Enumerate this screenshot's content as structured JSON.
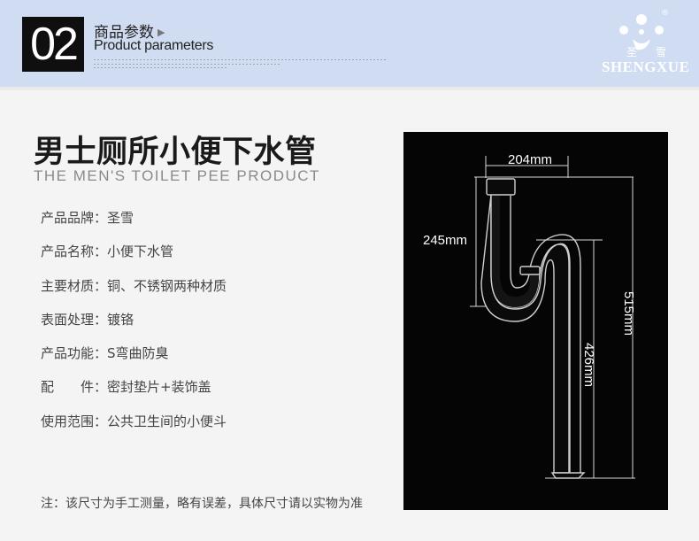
{
  "header": {
    "number": "02",
    "title_cn": "商品参数",
    "title_arrow": "▶",
    "title_en": "Product parameters"
  },
  "logo": {
    "brand_cn_1": "圣",
    "brand_cn_2": "雪",
    "brand_en": "SHENGXUE",
    "registered": "®"
  },
  "product": {
    "title": "男士厕所小便下水管",
    "subtitle_en": "THE MEN'S TOILET PEE PRODUCT"
  },
  "params": [
    "产品品牌：圣雪",
    "产品名称：小便下水管",
    "主要材质：铜、不锈钢两种材质",
    "表面处理：镀铬",
    "产品功能：S弯曲防臭",
    "配　　件：密封垫片+装饰盖",
    "使用范围：公共卫生间的小便斗"
  ],
  "note": "注：该尺寸为手工测量，略有误差，具体尺寸请以实物为准",
  "dimensions": {
    "width": "204mm",
    "bend": "245mm",
    "drop": "426mm",
    "total": "515mm"
  },
  "colors": {
    "header_bg": "#cfdcf1",
    "page_bg": "#f4f4f4",
    "diagram_bg": "#050505"
  }
}
